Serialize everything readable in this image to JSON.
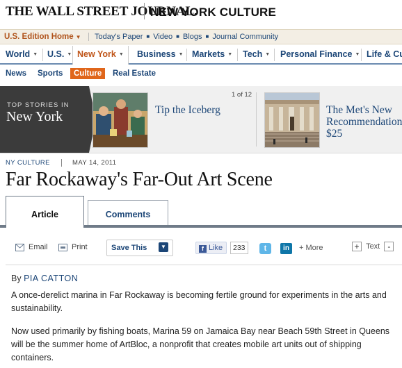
{
  "masthead": {
    "logo": "THE WALL STREET JOURNAL.",
    "section": "NEW YORK CULTURE"
  },
  "edition_bar": {
    "edition": "U.S. Edition Home",
    "links": [
      "Today's Paper",
      "Video",
      "Blogs",
      "Journal Community"
    ]
  },
  "main_nav": {
    "items": [
      "World",
      "U.S.",
      "New York",
      "Business",
      "Markets",
      "Tech",
      "Personal Finance",
      "Life & Cu"
    ],
    "active": "New York"
  },
  "sub_nav": {
    "items": [
      "News",
      "Sports",
      "Culture",
      "Real Estate"
    ],
    "active": "Culture"
  },
  "carousel": {
    "label_top": "TOP STORIES IN",
    "label_city": "New York",
    "counter": "1 of 12",
    "stories": [
      {
        "title": "Tip the Iceberg"
      },
      {
        "title": "The Met's New Recommendation $25"
      }
    ]
  },
  "article": {
    "kicker": "NY CULTURE",
    "date": "MAY 14, 2011",
    "headline": "Far Rockaway's Far-Out Art Scene",
    "tabs": [
      "Article",
      "Comments"
    ],
    "byline_prefix": "By",
    "author": "PIA CATTON",
    "paragraphs": [
      "A once-derelict marina in Far Rockaway is becoming fertile ground for experiments in the arts and sustainability.",
      "Now used primarily by fishing boats, Marina 59 on Jamaica Bay near Beach 59th Street in Queens will be the summer home of ArtBloc, a nonprofit that creates mobile art units out of shipping containers."
    ]
  },
  "toolbar": {
    "email": "Email",
    "print": "Print",
    "save": "Save This",
    "like": "Like",
    "like_count": "233",
    "more": "+ More",
    "text": "Text",
    "plus": "+",
    "minus": "-"
  }
}
